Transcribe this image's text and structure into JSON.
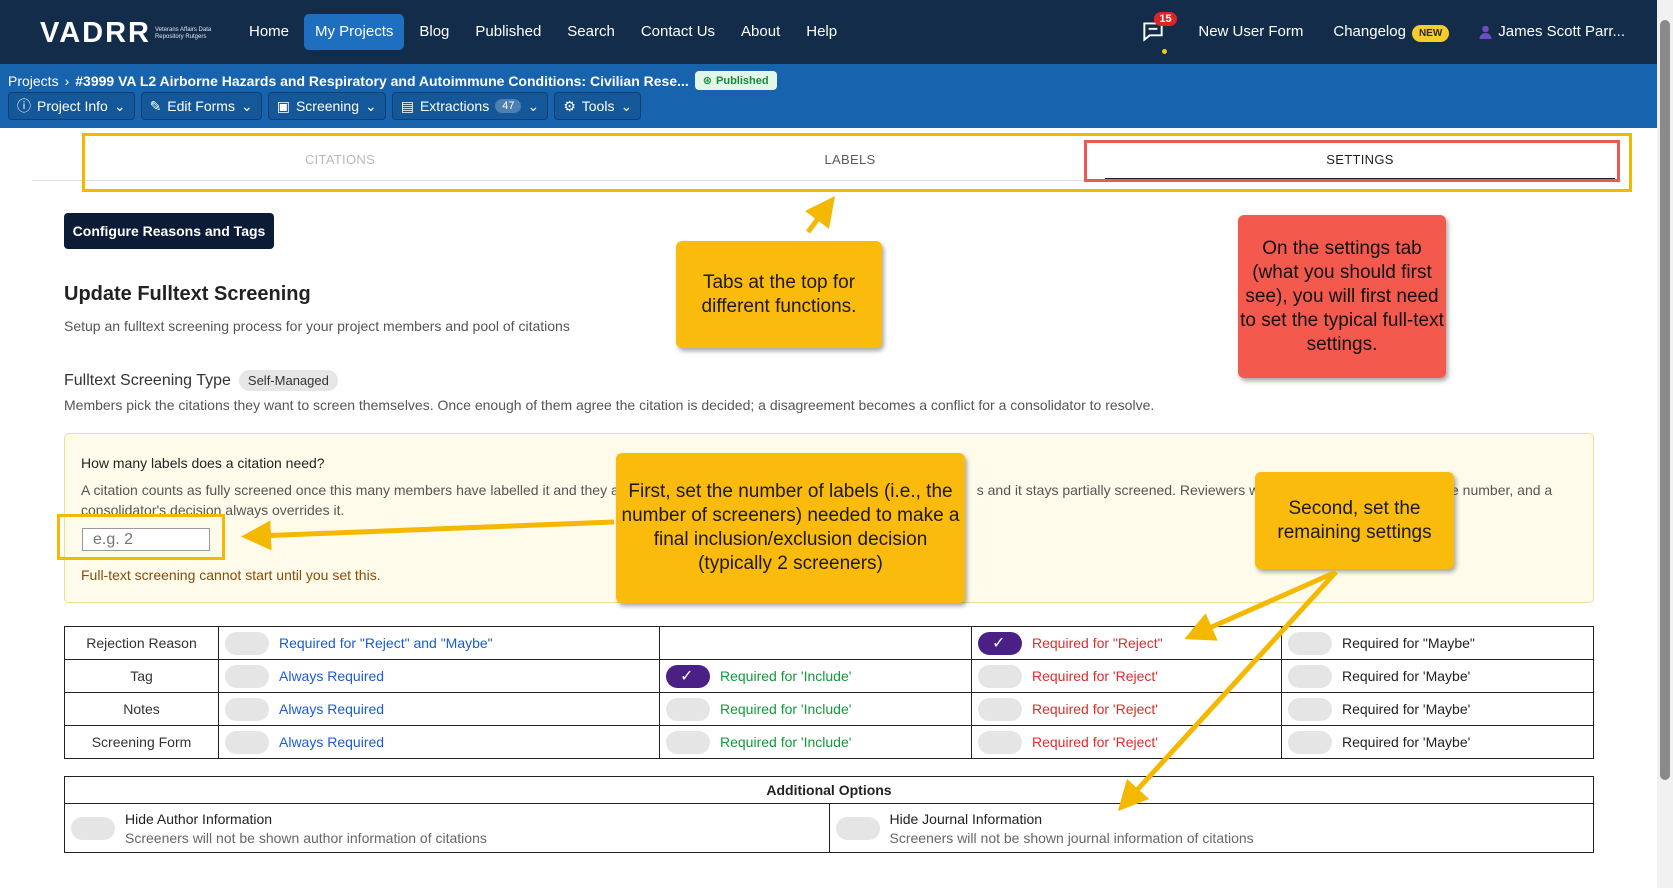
{
  "nav": {
    "logo": "VADRR",
    "logo_sub": "Veterans Affairs Data Repository Rutgers",
    "links": [
      "Home",
      "My Projects",
      "Blog",
      "Published",
      "Search",
      "Contact Us",
      "About",
      "Help"
    ],
    "chat_count": "15",
    "new_user_form": "New User Form",
    "changelog": "Changelog",
    "new_badge": "NEW",
    "user": "James Scott Parr..."
  },
  "project": {
    "breadcrumb": "Projects",
    "title": "#3999 VA L2 Airborne Hazards and Respiratory and Autoimmune Conditions: Civilian Rese...",
    "status": "Published",
    "toolbar": [
      "Project Info",
      "Edit Forms",
      "Screening",
      "Extractions",
      "Tools"
    ],
    "extractions_count": "47"
  },
  "tabs": [
    "CITATIONS",
    "LABELS",
    "SETTINGS"
  ],
  "configure_button": "Configure Reasons and Tags",
  "section": {
    "title": "Update Fulltext Screening",
    "subtitle": "Setup an fulltext screening process for your project members and pool of citations",
    "type_label": "Fulltext Screening Type",
    "type_value": "Self-Managed",
    "type_desc": "Members pick the citations they want to screen themselves. Once enough of them agree the citation is decided; a disagreement becomes a conflict for a consolidator to resolve."
  },
  "labels_box": {
    "question": "How many labels does a citation need?",
    "desc_start": "A citation counts as fully screened once this many members have labelled it and they a",
    "desc_end": "s and it stays partially screened. Reviewers who",
    "desc_tail": "r the number, and a",
    "desc_line2": "consolidator's decision always overrides it.",
    "placeholder": "e.g. 2",
    "warning": "Full-text screening cannot start until you set this."
  },
  "requirements": [
    {
      "name": "Rejection Reason",
      "cells": [
        {
          "label": "Required for \"Reject\" and \"Maybe\"",
          "color": "blue",
          "on": false
        },
        null,
        {
          "label": "Required for \"Reject\"",
          "color": "red",
          "on": true
        },
        {
          "label": "Required for \"Maybe\"",
          "color": "dark",
          "on": false
        }
      ]
    },
    {
      "name": "Tag",
      "cells": [
        {
          "label": "Always Required",
          "color": "blue",
          "on": false
        },
        {
          "label": "Required for 'Include'",
          "color": "green",
          "on": true
        },
        {
          "label": "Required for 'Reject'",
          "color": "red",
          "on": false
        },
        {
          "label": "Required for 'Maybe'",
          "color": "dark",
          "on": false
        }
      ]
    },
    {
      "name": "Notes",
      "cells": [
        {
          "label": "Always Required",
          "color": "blue",
          "on": false
        },
        {
          "label": "Required for 'Include'",
          "color": "green",
          "on": false
        },
        {
          "label": "Required for 'Reject'",
          "color": "red",
          "on": false
        },
        {
          "label": "Required for 'Maybe'",
          "color": "dark",
          "on": false
        }
      ]
    },
    {
      "name": "Screening Form",
      "cells": [
        {
          "label": "Always Required",
          "color": "blue",
          "on": false
        },
        {
          "label": "Required for 'Include'",
          "color": "green",
          "on": false
        },
        {
          "label": "Required for 'Reject'",
          "color": "red",
          "on": false
        },
        {
          "label": "Required for 'Maybe'",
          "color": "dark",
          "on": false
        }
      ]
    }
  ],
  "additional": {
    "header": "Additional Options",
    "items": [
      {
        "title": "Hide Author Information",
        "desc": "Screeners will not be shown author information of citations"
      },
      {
        "title": "Hide Journal Information",
        "desc": "Screeners will not be shown journal information of citations"
      }
    ]
  },
  "callouts": {
    "tabs": "Tabs at the top for different functions.",
    "settings": "On the settings tab (what you should first see), you will first need to set the typical full-text settings.",
    "labels": "First, set the number of labels (i.e., the number of screeners) needed to make a final inclusion/exclusion decision (typically 2 screeners)",
    "second": "Second, set the remaining settings"
  },
  "colors": {
    "navbar": "#122c4a",
    "projbar": "#1763ad",
    "callout_yellow": "#fbbb0c",
    "callout_red": "#f4594e",
    "toggle_on": "#4a1f86"
  }
}
